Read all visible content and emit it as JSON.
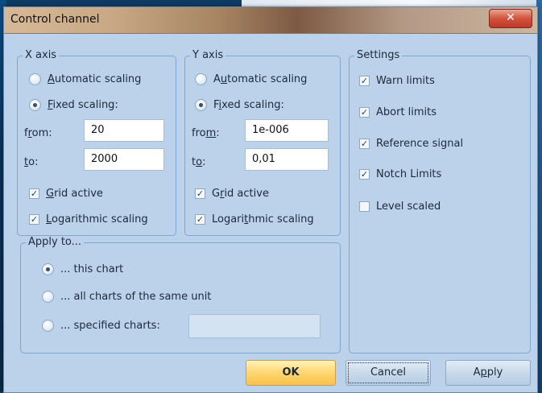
{
  "dialog": {
    "title": "Control channel",
    "close_icon": "close-icon"
  },
  "x_axis": {
    "group_title": "X axis",
    "automatic_scaling": {
      "label_pre": "",
      "label_ul": "A",
      "label_post": "utomatic scaling",
      "selected": false
    },
    "fixed_scaling": {
      "label_pre": "",
      "label_ul": "F",
      "label_post": "ixed scaling:",
      "selected": true
    },
    "from_label": {
      "pre": "f",
      "ul": "r",
      "post": "om:"
    },
    "from_value": "20",
    "to_label": {
      "pre": "",
      "ul": "t",
      "post": "o:"
    },
    "to_value": "2000",
    "grid_active": {
      "label_pre": "",
      "label_ul": "G",
      "label_post": "rid active",
      "checked": true
    },
    "logarithmic_scaling": {
      "label_pre": "",
      "label_ul": "L",
      "label_post": "ogarithmic scaling",
      "checked": true
    }
  },
  "y_axis": {
    "group_title": "Y axis",
    "automatic_scaling": {
      "label_pre": "A",
      "label_ul": "u",
      "label_post": "tomatic scaling",
      "selected": false
    },
    "fixed_scaling": {
      "label_pre": "F",
      "label_ul": "i",
      "label_post": "xed scaling:",
      "selected": true
    },
    "from_label": {
      "pre": "fro",
      "ul": "m",
      "post": ":"
    },
    "from_value": "1e-006",
    "to_label": {
      "pre": "t",
      "ul": "o",
      "post": ":"
    },
    "to_value": "0,01",
    "grid_active": {
      "label_pre": "G",
      "label_ul": "r",
      "label_post": "id active",
      "checked": true
    },
    "logarithmic_scaling": {
      "label_pre": "Logari",
      "label_ul": "t",
      "label_post": "hmic scaling",
      "checked": true
    }
  },
  "settings": {
    "group_title": "Settings",
    "items": [
      {
        "label": "Warn limits",
        "checked": true
      },
      {
        "label": "Abort limits",
        "checked": true
      },
      {
        "label": "Reference signal",
        "checked": true
      },
      {
        "label": "Notch Limits",
        "checked": true
      },
      {
        "label": "Level scaled",
        "checked": false
      }
    ]
  },
  "apply_to": {
    "group_title": "Apply to...",
    "options": [
      {
        "label": "... this chart",
        "selected": true
      },
      {
        "label": "... all charts of the same unit",
        "selected": false
      },
      {
        "label": "... specified charts:",
        "selected": false
      }
    ],
    "specified_charts_value": ""
  },
  "buttons": {
    "ok": "OK",
    "cancel": "Cancel",
    "apply_pre": "A",
    "apply_ul": "p",
    "apply_post": "ply"
  },
  "colors": {
    "dialog_bg": "#bcd2ea",
    "group_border": "#7ea6d2",
    "ok_button": "#ffd670",
    "close_button": "#d2523b"
  }
}
